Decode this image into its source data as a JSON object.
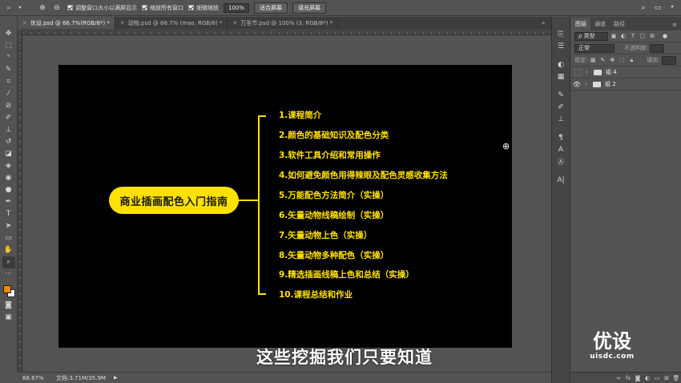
{
  "options_bar": {
    "checkbox_resize": "调整窗口大小以满屏显示",
    "checkbox_zoom_all": "缩放所有窗口",
    "checkbox_scrubby": "细微缩放",
    "zoom_value": "100%",
    "fit_screen": "适合屏幕",
    "fill_screen": "填充屏幕"
  },
  "tabs": [
    {
      "label": "优设.psd @ 66.7%(RGB/8*) *",
      "active": true
    },
    {
      "label": "动物.psd @ 66.7% (mao, RGB/8) *",
      "active": false
    },
    {
      "label": "万圣节.psd @ 100% (3, RGB/8*) *",
      "active": false
    }
  ],
  "canvas": {
    "main_topic": "商业插画配色入门指南",
    "items": [
      "1.课程简介",
      "2.颜色的基础知识及配色分类",
      "3.软件工具介绍和常用操作",
      "4.如何避免颜色用得辣眼及配色灵感收集方法",
      "5.万能配色方法简介（实操）",
      "6.矢量动物线稿绘制（实操）",
      "7.矢量动物上色（实操）",
      "8.矢量动物多种配色（实操）",
      "9.精选插画线稿上色和总结（实操）",
      "10.课程总结和作业"
    ],
    "accent_color": "#ffe100",
    "background_color": "#000000"
  },
  "subtitle": "这些挖掘我们只要知道",
  "status": {
    "zoom": "66.67%",
    "doc": "文档:3.71M/35.9M"
  },
  "layers_panel": {
    "tabs": [
      "图层",
      "通道",
      "路径"
    ],
    "filter_label": "ρ 类型",
    "blend_mode": "正常",
    "opacity_label": "不透明度:",
    "lock_label": "锁定:",
    "fill_label": "填充:",
    "layers": [
      {
        "name": "组 4",
        "visible": false
      },
      {
        "name": "组 2",
        "visible": true
      }
    ]
  },
  "watermark": {
    "title": "优设",
    "domain": "uisdc.com"
  },
  "colors": {
    "foreground": "#f08a00",
    "background": "#ffffff"
  }
}
